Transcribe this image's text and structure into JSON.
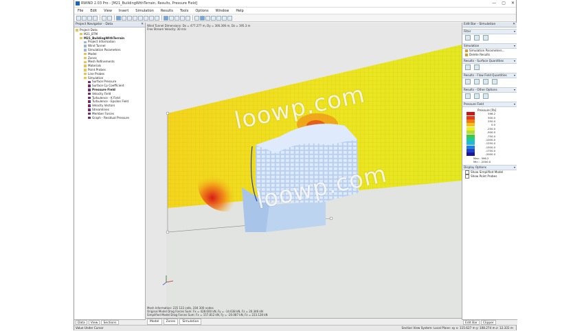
{
  "window": {
    "title": "RWIND 2.03 Pro - [M21_BuildingWithTerrain, Results, Pressure Field]",
    "controls": [
      "—",
      "▢",
      "✕"
    ]
  },
  "menu": [
    "File",
    "Edit",
    "View",
    "Insert",
    "Simulation",
    "Results",
    "Tools",
    "Options",
    "Window",
    "Help"
  ],
  "navigator": {
    "title": "Project Navigator - Data",
    "items": [
      {
        "label": "Project Data",
        "indent": 0,
        "icon": "folder"
      },
      {
        "label": "M21_BTM",
        "indent": 1,
        "icon": "folder"
      },
      {
        "label": "M21_BuildingWithTerrain",
        "indent": 1,
        "icon": "folder",
        "bold": true
      },
      {
        "label": "Project Information",
        "indent": 2,
        "icon": "doc"
      },
      {
        "label": "Wind Tunnel",
        "indent": 2,
        "icon": "doc"
      },
      {
        "label": "Simulation Parameters",
        "indent": 2,
        "icon": "doc"
      },
      {
        "label": "Model",
        "indent": 2,
        "icon": "folder"
      },
      {
        "label": "Zones",
        "indent": 2,
        "icon": "folder"
      },
      {
        "label": "Mesh Refinements",
        "indent": 2,
        "icon": "folder"
      },
      {
        "label": "Materials",
        "indent": 2,
        "icon": "folder"
      },
      {
        "label": "Point Probes",
        "indent": 2,
        "icon": "folder"
      },
      {
        "label": "Line Probes",
        "indent": 2,
        "icon": "folder"
      },
      {
        "label": "Simulation",
        "indent": 2,
        "icon": "folder"
      },
      {
        "label": "Surface Pressure",
        "indent": 3,
        "icon": "res"
      },
      {
        "label": "Surface Cp Coefficient",
        "indent": 3,
        "icon": "res"
      },
      {
        "label": "Pressure Field",
        "indent": 3,
        "icon": "res",
        "bold": true
      },
      {
        "label": "Velocity Field",
        "indent": 3,
        "icon": "res"
      },
      {
        "label": "Turbulence - K Field",
        "indent": 3,
        "icon": "res"
      },
      {
        "label": "Turbulence - Epsilon Field",
        "indent": 3,
        "icon": "res"
      },
      {
        "label": "Velocity Vectors",
        "indent": 3,
        "icon": "res"
      },
      {
        "label": "Streamlines",
        "indent": 3,
        "icon": "res"
      },
      {
        "label": "Member Forces",
        "indent": 3,
        "icon": "res"
      },
      {
        "label": "Graph - Residual Pressure",
        "indent": 3,
        "icon": "res"
      }
    ],
    "tabs": [
      "Data",
      "View",
      "Sections"
    ]
  },
  "viewport": {
    "info_line1": "Wind Tunnel Dimensions: Dx = 477.277 m, Dy = 306.306 m, Dz = 195.3 m",
    "info_line2": "Free Stream Velocity: 30 m/s",
    "bottom_line1": "Mesh Information: 235 122 cells, 204 300 nodes",
    "bottom_line2": "Original Model Drag Forces Sum: Fx = 428.600 kN, Fy = -14.638 kN, Fz = 20.346 kN",
    "bottom_line3": "Simplified Model Drag Forces Sum: Fx = 157.812 kN, Fy = -20.087 kN, Fz = 223.128 kN",
    "tabs": [
      "Model",
      "Zones",
      "Simulation"
    ],
    "watermark": "loowp.com"
  },
  "editbar": {
    "title": "Edit Bar - Simulation",
    "sections": {
      "filter": "Filter",
      "simulation": "Simulation",
      "sim_items": [
        "Simulation Parameters...",
        "Delete Results"
      ],
      "surface_q": "Results - Surface Quantities",
      "flow_q": "Results - Flow Field Quantities",
      "other": "Results - Other Options",
      "pressure": "Pressure Field",
      "display": "Display Options"
    },
    "legend": {
      "title": "Pressure [Pa]",
      "entries": [
        {
          "value": "596.2",
          "color": "#c81818"
        },
        {
          "value": "500.0",
          "color": "#e83a18"
        },
        {
          "value": "250.0",
          "color": "#f07818"
        },
        {
          "value": "0.0",
          "color": "#f4c018"
        },
        {
          "value": "-250.0",
          "color": "#eeee20"
        },
        {
          "value": "-500.0",
          "color": "#b0e030"
        },
        {
          "value": "-750.0",
          "color": "#40c840"
        },
        {
          "value": "-1000.0",
          "color": "#20c8a0"
        },
        {
          "value": "-1250.0",
          "color": "#20b8e0"
        },
        {
          "value": "-1500.0",
          "color": "#2080e0"
        },
        {
          "value": "-1750.0",
          "color": "#2040c8"
        },
        {
          "value": "-2000.0",
          "color": "#1818a0"
        }
      ],
      "max_label": "Max :",
      "max_value": "596.2",
      "min_label": "Min :",
      "min_value": "-2000.0"
    },
    "display_options": [
      "Show Simplified Model",
      "Show Point Probes"
    ],
    "tabs": [
      "Edit Bar",
      "Clipper"
    ]
  },
  "status": {
    "left": "Value Under Cursor",
    "right": "Section View    System: Local    Plane: xy    x: 115.627 m    y: 108.274 m    z: 12.331 m"
  }
}
